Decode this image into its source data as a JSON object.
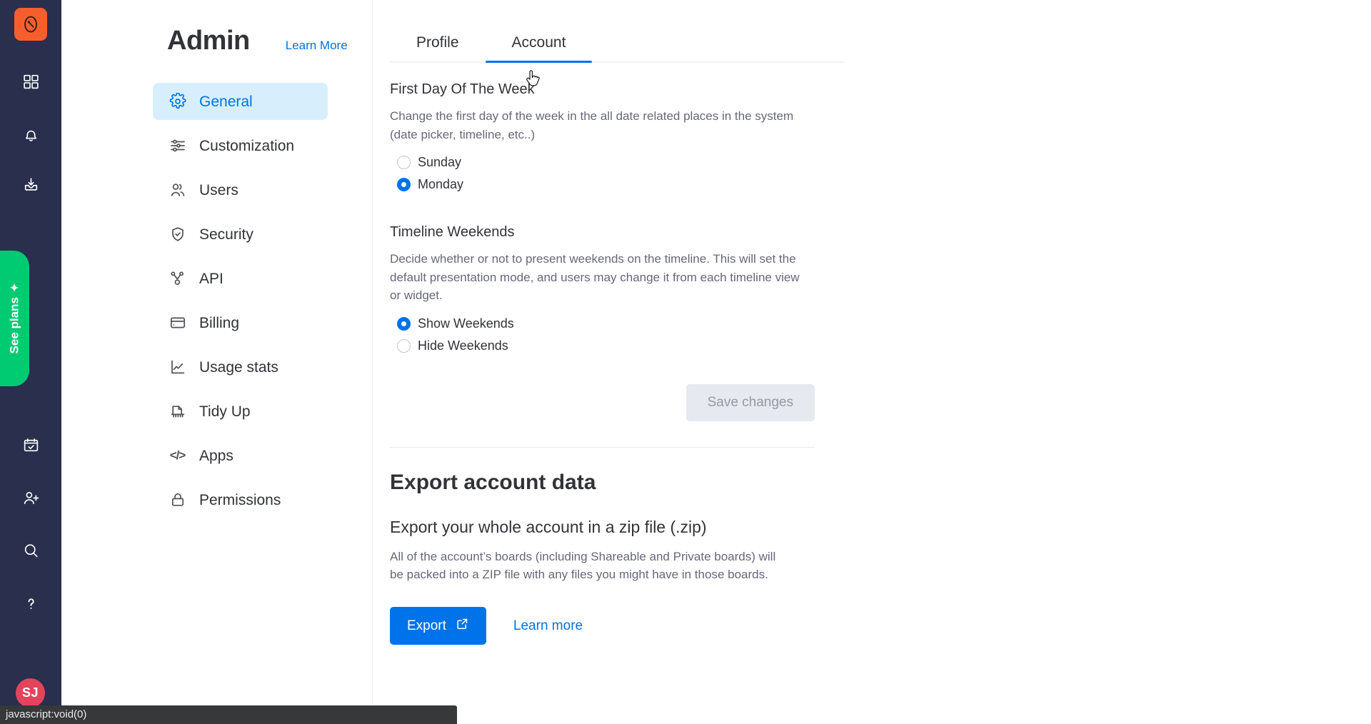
{
  "rail": {
    "logo_icon": "monday-logo-icon",
    "items": [
      {
        "name": "dashboard-icon",
        "label": "Dashboard"
      },
      {
        "name": "bell-icon",
        "label": "Notifications"
      },
      {
        "name": "inbox-icon",
        "label": "Inbox"
      },
      {
        "name": "calendar-check-icon",
        "label": "My Work"
      },
      {
        "name": "invite-user-icon",
        "label": "Invite members"
      },
      {
        "name": "search-icon",
        "label": "Search"
      },
      {
        "name": "help-icon",
        "label": "Help"
      }
    ],
    "see_plans": {
      "label": "See plans",
      "sparkle": "✦",
      "color": "#00ca72"
    },
    "avatar": {
      "initials": "SJ",
      "color": "#e2445c"
    }
  },
  "sidebar": {
    "title": "Admin",
    "learn_more": "Learn More",
    "items": [
      {
        "label": "General",
        "icon": "gear-icon",
        "active": true
      },
      {
        "label": "Customization",
        "icon": "sliders-icon",
        "active": false
      },
      {
        "label": "Users",
        "icon": "users-icon",
        "active": false
      },
      {
        "label": "Security",
        "icon": "shield-check-icon",
        "active": false
      },
      {
        "label": "API",
        "icon": "api-nodes-icon",
        "active": false
      },
      {
        "label": "Billing",
        "icon": "credit-card-icon",
        "active": false
      },
      {
        "label": "Usage stats",
        "icon": "line-chart-icon",
        "active": false
      },
      {
        "label": "Tidy Up",
        "icon": "tidy-up-icon",
        "active": false
      },
      {
        "label": "Apps",
        "icon": "code-icon",
        "active": false
      },
      {
        "label": "Permissions",
        "icon": "lock-icon",
        "active": false
      }
    ]
  },
  "main": {
    "tabs": [
      {
        "label": "Profile",
        "active": false
      },
      {
        "label": "Account",
        "active": true
      }
    ],
    "first_day": {
      "title": "First Day Of The Week",
      "description": "Change the first day of the week in the all date related places in the system (date picker, timeline, etc..)",
      "options": [
        {
          "label": "Sunday",
          "checked": false
        },
        {
          "label": "Monday",
          "checked": true
        }
      ]
    },
    "timeline_weekends": {
      "title": "Timeline Weekends",
      "description": "Decide whether or not to present weekends on the timeline. This will set the default presentation mode, and users may change it from each timeline view or widget.",
      "options": [
        {
          "label": "Show Weekends",
          "checked": true
        },
        {
          "label": "Hide Weekends",
          "checked": false
        }
      ]
    },
    "save_label": "Save changes",
    "save_disabled": true,
    "export": {
      "title": "Export account data",
      "subtitle": "Export your whole account in a zip file (.zip)",
      "body": "All of the account’s boards (including Shareable and Private boards) will be packed into a ZIP file with any files you might have in those boards.",
      "button_label": "Export",
      "button_icon": "external-link-icon",
      "learn_more": "Learn more"
    }
  },
  "statusbar": {
    "text": "javascript:void(0)"
  },
  "colors": {
    "accent": "#0073ea",
    "rail": "#292f4c",
    "brand": "#f65f2d",
    "success": "#00ca72",
    "avatar": "#e2445c"
  }
}
